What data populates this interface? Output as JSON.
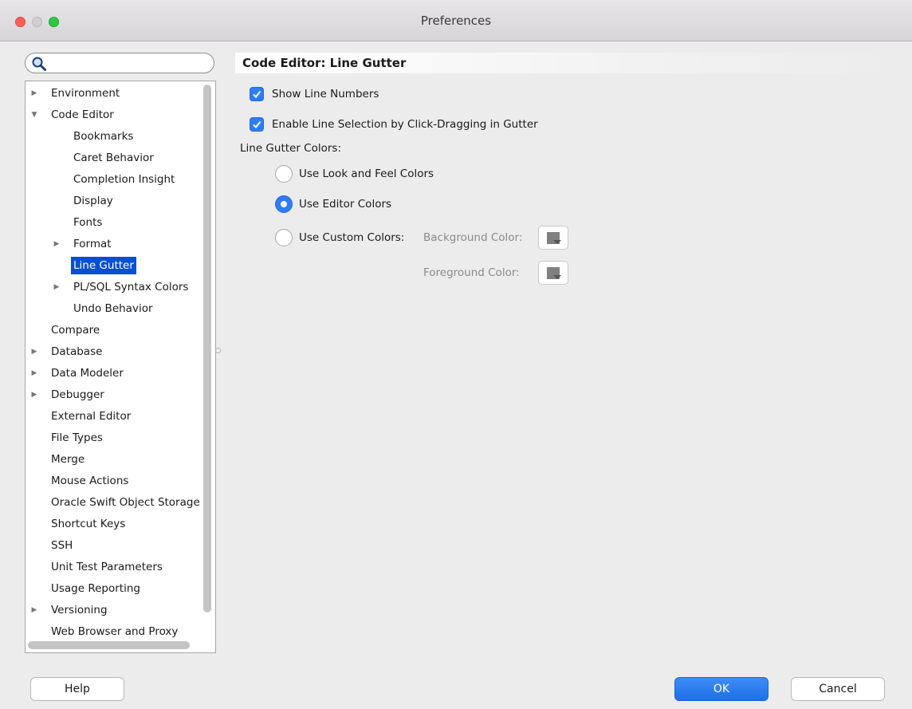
{
  "window": {
    "title": "Preferences"
  },
  "search": {
    "placeholder": ""
  },
  "tree": {
    "items": [
      {
        "label": "Environment",
        "arrow": "right"
      },
      {
        "label": "Code Editor",
        "arrow": "down"
      },
      {
        "label": "Bookmarks",
        "arrow": ""
      },
      {
        "label": "Caret Behavior",
        "arrow": ""
      },
      {
        "label": "Completion Insight",
        "arrow": ""
      },
      {
        "label": "Display",
        "arrow": ""
      },
      {
        "label": "Fonts",
        "arrow": ""
      },
      {
        "label": "Format",
        "arrow": "right"
      },
      {
        "label": "Line Gutter",
        "arrow": "",
        "selected": true
      },
      {
        "label": "PL/SQL Syntax Colors",
        "arrow": "right"
      },
      {
        "label": "Undo Behavior",
        "arrow": ""
      },
      {
        "label": "Compare",
        "arrow": ""
      },
      {
        "label": "Database",
        "arrow": "right"
      },
      {
        "label": "Data Modeler",
        "arrow": "right"
      },
      {
        "label": "Debugger",
        "arrow": "right"
      },
      {
        "label": "External Editor",
        "arrow": ""
      },
      {
        "label": "File Types",
        "arrow": ""
      },
      {
        "label": "Merge",
        "arrow": ""
      },
      {
        "label": "Mouse Actions",
        "arrow": ""
      },
      {
        "label": "Oracle Swift Object Storage",
        "arrow": ""
      },
      {
        "label": "Shortcut Keys",
        "arrow": ""
      },
      {
        "label": "SSH",
        "arrow": ""
      },
      {
        "label": "Unit Test Parameters",
        "arrow": ""
      },
      {
        "label": "Usage Reporting",
        "arrow": ""
      },
      {
        "label": "Versioning",
        "arrow": "right"
      },
      {
        "label": "Web Browser and Proxy",
        "arrow": ""
      }
    ]
  },
  "content": {
    "title": "Code Editor: Line Gutter",
    "show_line_numbers": {
      "label": "Show Line Numbers",
      "checked": true
    },
    "enable_line_selection": {
      "label": "Enable Line Selection by Click-Dragging in Gutter",
      "checked": true
    },
    "colors_label": "Line Gutter Colors:",
    "radio_look_feel": "Use Look and Feel Colors",
    "radio_editor": "Use Editor Colors",
    "radio_custom": "Use Custom Colors:",
    "selected_option": "Use Editor Colors",
    "background_color_label": "Background Color:",
    "foreground_color_label": "Foreground Color:"
  },
  "buttons": {
    "help": "Help",
    "ok": "OK",
    "cancel": "Cancel"
  },
  "colors": {
    "accent": "#2f7cf6",
    "selection": "#0a4fd3"
  },
  "icons": {
    "search": "search-icon",
    "color_picker": "color-picker-icon"
  }
}
